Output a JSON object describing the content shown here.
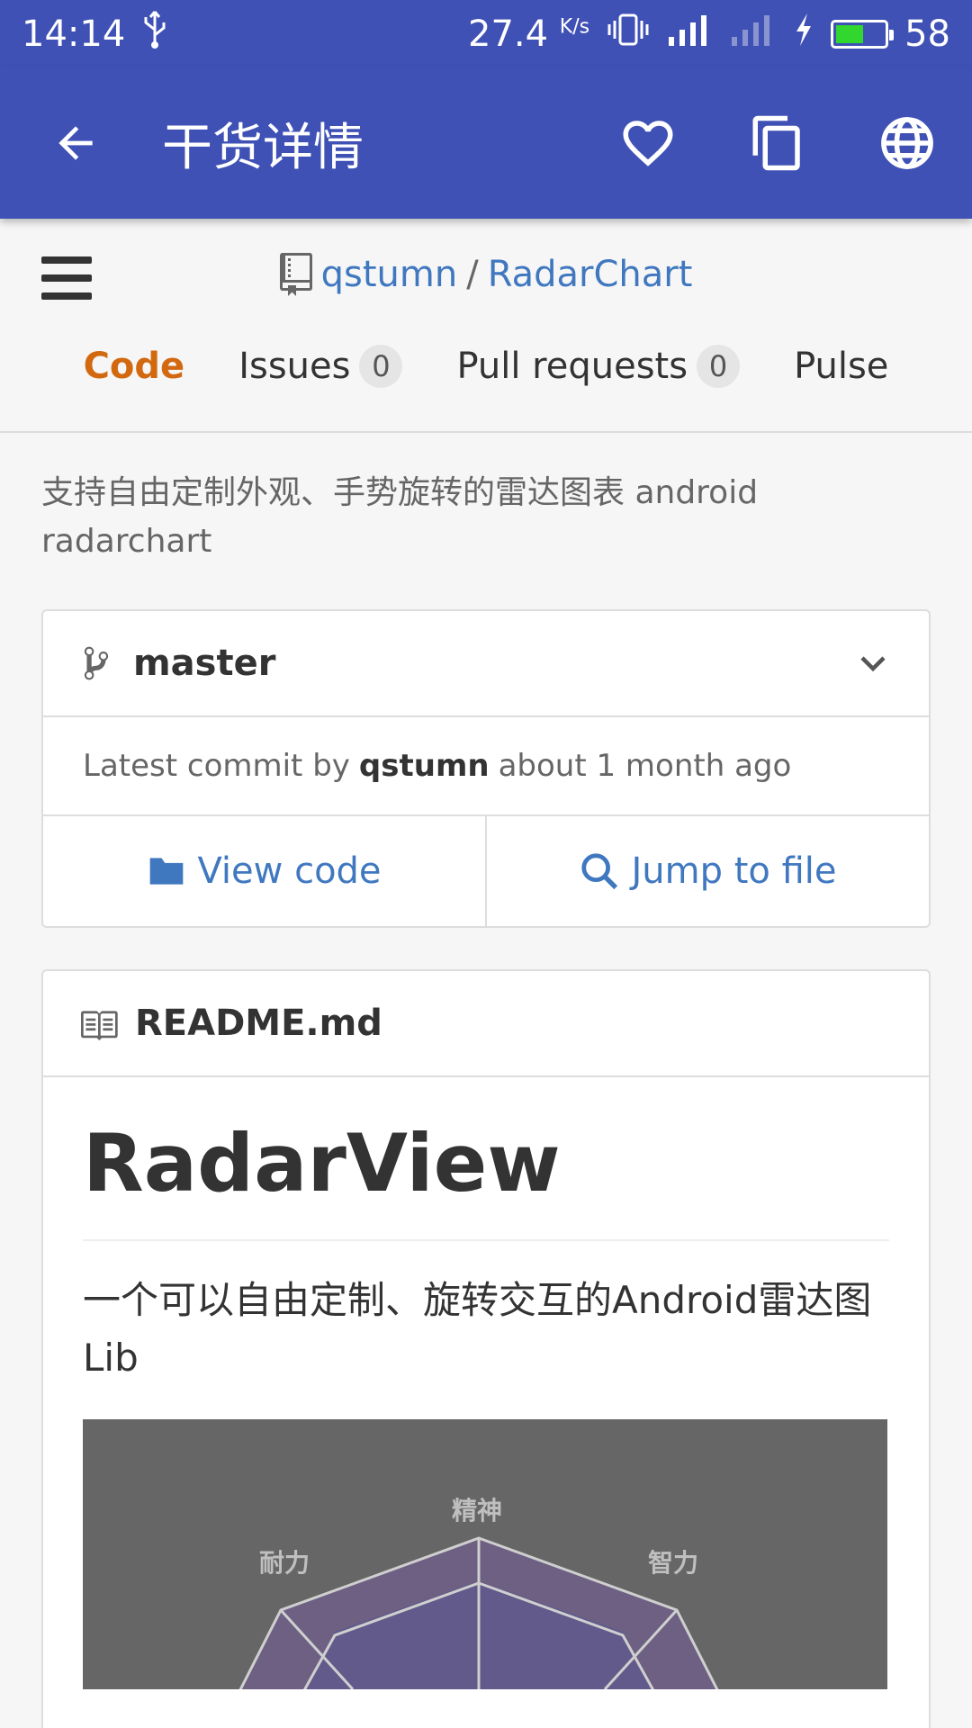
{
  "status_bar": {
    "time": "14:14",
    "speed": "27.4",
    "speed_unit": "K/s",
    "battery": "58",
    "battery_level": 0.58,
    "battery_color": "#31d62f"
  },
  "app_bar": {
    "title": "干货详情",
    "bg_color": "#3f51b5",
    "icons": [
      "back-arrow-icon",
      "heart-icon",
      "copy-icon",
      "globe-icon"
    ]
  },
  "repo": {
    "owner": "qstumn",
    "separator": "/",
    "name": "RadarChart",
    "description": "支持自由定制外观、手势旋转的雷达图表 android radarchart",
    "tabs": [
      {
        "label": "Code",
        "count": null,
        "active": true
      },
      {
        "label": "Issues",
        "count": "0",
        "active": false
      },
      {
        "label": "Pull requests",
        "count": "0",
        "active": false
      },
      {
        "label": "Pulse",
        "count": null,
        "active": false
      }
    ],
    "link_color": "#4078c0",
    "active_tab_color": "#d26911"
  },
  "branch": {
    "name": "master"
  },
  "commit": {
    "prefix": "Latest commit by",
    "author": "qstumn",
    "time": "about 1 month ago"
  },
  "buttons": {
    "view_code": "View code",
    "jump_to_file": "Jump to file"
  },
  "readme": {
    "filename": "README.md",
    "heading": "RadarView",
    "intro": "一个可以自由定制、旋转交互的Android雷达图Lib",
    "image_labels": [
      "精神",
      "耐力",
      "智力"
    ]
  }
}
